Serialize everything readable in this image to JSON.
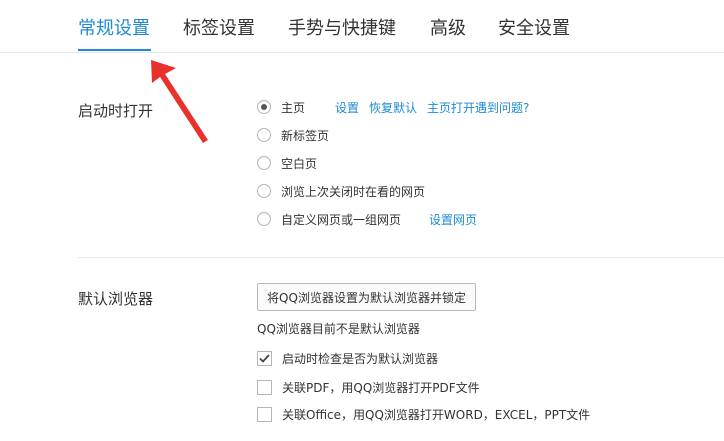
{
  "tabs": [
    {
      "label": "常规设置",
      "active": true
    },
    {
      "label": "标签设置"
    },
    {
      "label": "手势与快捷键"
    },
    {
      "label": "高级"
    },
    {
      "label": "安全设置"
    }
  ],
  "startup": {
    "title": "启动时打开",
    "options": [
      {
        "label": "主页",
        "checked": true
      },
      {
        "label": "新标签页"
      },
      {
        "label": "空白页"
      },
      {
        "label": "浏览上次关闭时在看的网页"
      },
      {
        "label": "自定义网页或一组网页"
      }
    ],
    "home_links": {
      "settings": "设置",
      "restore": "恢复默认",
      "problem": "主页打开遇到问题?"
    },
    "custom_link": "设置网页"
  },
  "default_browser": {
    "title": "默认浏览器",
    "button": "将QQ浏览器设置为默认浏览器并锁定",
    "status": "QQ浏览器目前不是默认浏览器",
    "checks": [
      {
        "label": "启动时检查是否为默认浏览器",
        "checked": true
      },
      {
        "label": "关联PDF，用QQ浏览器打开PDF文件",
        "checked": false
      },
      {
        "label": "关联Office，用QQ浏览器打开WORD，EXCEL，PPT文件",
        "checked": false
      }
    ]
  },
  "colors": {
    "accent": "#1e8bd6",
    "annotation_arrow": "#e8312a"
  }
}
